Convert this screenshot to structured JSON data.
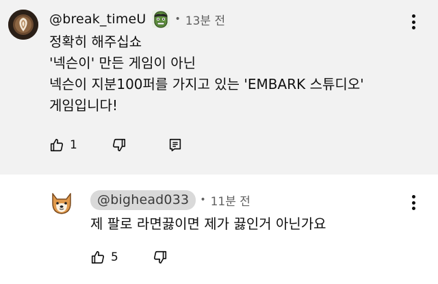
{
  "comments": [
    {
      "author": "@break_timeU",
      "time": "13분 전",
      "separator": "•",
      "lines": [
        "정확히 해주십쇼",
        "'넥슨이' 만든 게임이 아닌",
        "넥슨이 지분100퍼를 가지고 있는 'EMBARK 스튜디오'",
        "게임입니다!"
      ],
      "likes": "1",
      "icons": {
        "avatar": "latte-art-avatar",
        "badge": "green-hulk-badge-icon",
        "like": "thumbs-up-icon",
        "dislike": "thumbs-down-icon",
        "reply": "reply-icon",
        "more": "more-vertical-icon"
      }
    },
    {
      "author": "@bighead033",
      "time": "11분 전",
      "separator": "•",
      "lines": [
        "제 팔로 라면끓이면 제가 끓인거 아닌가요"
      ],
      "likes": "5",
      "icons": {
        "avatar": "shiba-dog-avatar",
        "like": "thumbs-up-icon",
        "dislike": "thumbs-down-icon",
        "more": "more-vertical-icon"
      }
    }
  ],
  "colors": {
    "main_background": "#f2f2f2",
    "secondary_text": "#606060",
    "author_pill": "#d9d9d9"
  }
}
